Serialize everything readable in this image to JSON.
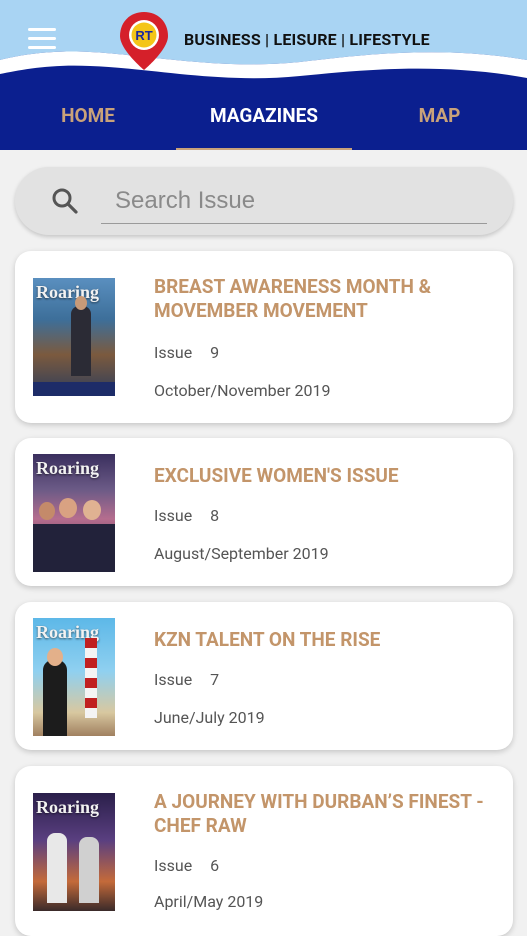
{
  "header": {
    "tagline": "BUSINESS | LEISURE | LIFESTYLE",
    "logo_text": "RT",
    "colors": {
      "navy": "#0b1f8f",
      "sky": "#a9d4f3",
      "accent": "#c9a27a",
      "logo_red": "#d5202a"
    }
  },
  "tabs": [
    {
      "label": "HOME"
    },
    {
      "label": "MAGAZINES"
    },
    {
      "label": "MAP"
    }
  ],
  "active_tab": "MAGAZINES",
  "search": {
    "placeholder": "Search Issue",
    "value": ""
  },
  "issues": [
    {
      "title": "BREAST AWARENESS MONTH & MOVEMBER MOVEMENT",
      "issue_label": "Issue",
      "issue_number": "9",
      "date": "October/November 2019",
      "cover_brand": "Roaring"
    },
    {
      "title": "EXCLUSIVE WOMEN'S ISSUE",
      "issue_label": "Issue",
      "issue_number": "8",
      "date": "August/September 2019",
      "cover_brand": "Roaring"
    },
    {
      "title": "KZN TALENT ON THE RISE",
      "issue_label": "Issue",
      "issue_number": "7",
      "date": "June/July 2019",
      "cover_brand": "Roaring"
    },
    {
      "title": "A JOURNEY WITH DURBAN’S FINEST - CHEF RAW",
      "issue_label": "Issue",
      "issue_number": "6",
      "date": "April/May 2019",
      "cover_brand": "Roaring"
    }
  ]
}
